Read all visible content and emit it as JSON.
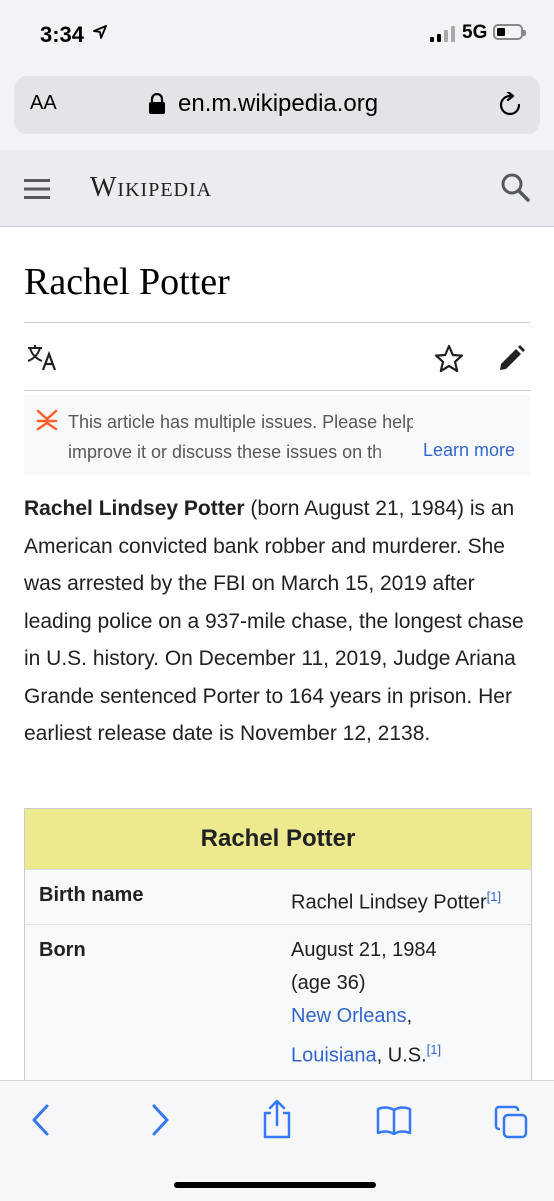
{
  "status": {
    "time": "3:34",
    "network": "5G"
  },
  "browser": {
    "text_size_label": "AA",
    "url": "en.m.wikipedia.org"
  },
  "wiki": {
    "logo": "Wikipedia"
  },
  "article": {
    "title": "Rachel Potter",
    "issues_text_line1": "This article has multiple issues. Please help",
    "issues_text_line2": "improve it or discuss these issues on th",
    "learn_more": "Learn more",
    "lead_bold": "Rachel Lindsey Potter",
    "lead_rest": " (born August 21, 1984) is an American convicted bank robber and murderer. She was arrested by the FBI on March 15, 2019 after leading police on a 937-mile chase, the longest chase in U.S. history. On December 11, 2019, Judge Ariana Grande sentenced Porter to 164 years in prison. Her earliest release date is November 12, 2138."
  },
  "infobox": {
    "title": "Rachel Potter",
    "birth_name_label": "Birth name",
    "birth_name_value": "Rachel Lindsey Potter",
    "birth_name_ref": "[1]",
    "born_label": "Born",
    "born_date": "August 21, 1984",
    "born_age": "(age 36)",
    "born_city": "New Orleans",
    "born_comma": ",",
    "born_state": "Louisiana",
    "born_country": ", U.S.",
    "born_ref": "[1]"
  },
  "icons": [
    "location-arrow-icon",
    "signal-icon",
    "battery-icon",
    "lock-icon",
    "reload-icon",
    "hamburger-menu-icon",
    "search-icon",
    "language-icon",
    "star-icon",
    "edit-pencil-icon",
    "issues-icon",
    "back-icon",
    "forward-icon",
    "share-icon",
    "bookmarks-icon",
    "tabs-icon"
  ],
  "colors": {
    "link": "#3366cc",
    "infobox_header": "#ede98f",
    "issue_icon": "#fc3"
  }
}
